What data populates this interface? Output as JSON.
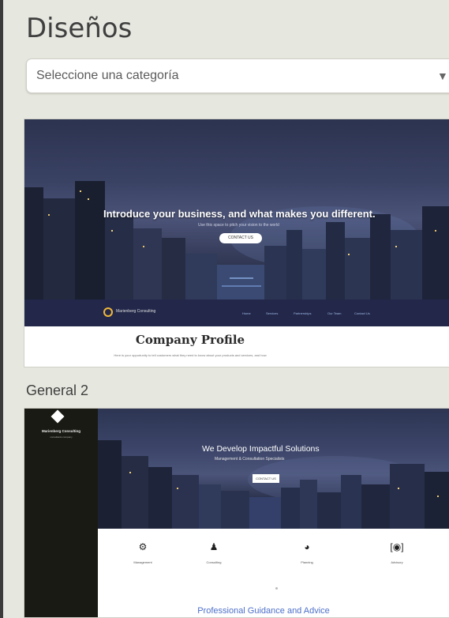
{
  "page": {
    "title": "Diseños",
    "category_select": {
      "value": "Seleccione una categoría",
      "arrow": "▼"
    }
  },
  "designs": [
    {
      "label": "",
      "preview": {
        "headline": "Introduce your business, and what makes you different.",
        "subtitle": "Use this space to pitch your vision to the world",
        "button": "CONTACT US",
        "logo_text": "Marienberg Consulting",
        "nav": [
          "Home",
          "Services",
          "Partnerships",
          "Our Team",
          "Contact Us"
        ],
        "title": "Company Profile",
        "description": "Here is your opportunity to tell customers what they need to know about your products and services, and how"
      }
    },
    {
      "label": "General 2",
      "preview": {
        "brand": "Marienberg Consulting",
        "tagline": "consultants company",
        "headline": "We Develop Impactful Solutions",
        "subtitle": "Management & Consultation Specialists",
        "button": "CONTACT US",
        "services": [
          {
            "icon": "gear-icon",
            "glyph": "⚙",
            "label": "Management"
          },
          {
            "icon": "person-icon",
            "glyph": "♟",
            "label": "Consulting"
          },
          {
            "icon": "pie-chart-icon",
            "glyph": "◕",
            "label": "Planning"
          },
          {
            "icon": "advisory-icon",
            "glyph": "[◉]",
            "label": "Advisory"
          }
        ],
        "heading": "Professional Guidance and Advice"
      }
    }
  ],
  "colors": {
    "background": "#e6e7df",
    "hero_navy": "#23284a",
    "sidebar_dark": "#1a1a14",
    "link_blue": "#4d6fc9",
    "logo_gold": "#f0b83a"
  }
}
